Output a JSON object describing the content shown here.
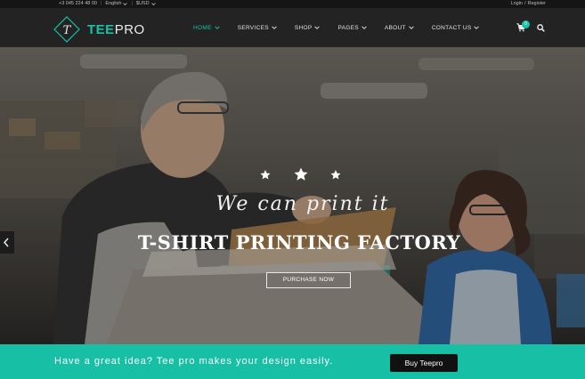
{
  "topbar": {
    "phone": "+3 045 224 48 00",
    "language": "English",
    "currency": "$USD",
    "login": "Login",
    "divider": "/",
    "register": "Register"
  },
  "brand": {
    "tee": "TEE",
    "pro": "PRO",
    "mark_letter": "T"
  },
  "nav": {
    "items": [
      {
        "label": "HOME"
      },
      {
        "label": "SERVICES"
      },
      {
        "label": "SHOP"
      },
      {
        "label": "PAGES"
      },
      {
        "label": "ABOUT"
      },
      {
        "label": "CONTACT US"
      }
    ],
    "active": "HOME",
    "cart_count": "0"
  },
  "hero": {
    "tagline": "We can print it",
    "title": "T-SHIRT PRINTING FACTORY",
    "button": "PURCHASE NOW"
  },
  "cta": {
    "text": "Have a great idea? Tee pro makes your design easily.",
    "button": "Buy Teepro"
  },
  "colors": {
    "accent": "#16c1a6",
    "header_bg": "#232323",
    "topbar_bg": "#151515",
    "cta_bg": "#17bfa4",
    "cta_button_bg": "#111111"
  },
  "icons": [
    "logo-mark-icon",
    "chevron-down-icon",
    "cart-icon",
    "search-icon",
    "star-icon",
    "chevron-left-icon"
  ]
}
